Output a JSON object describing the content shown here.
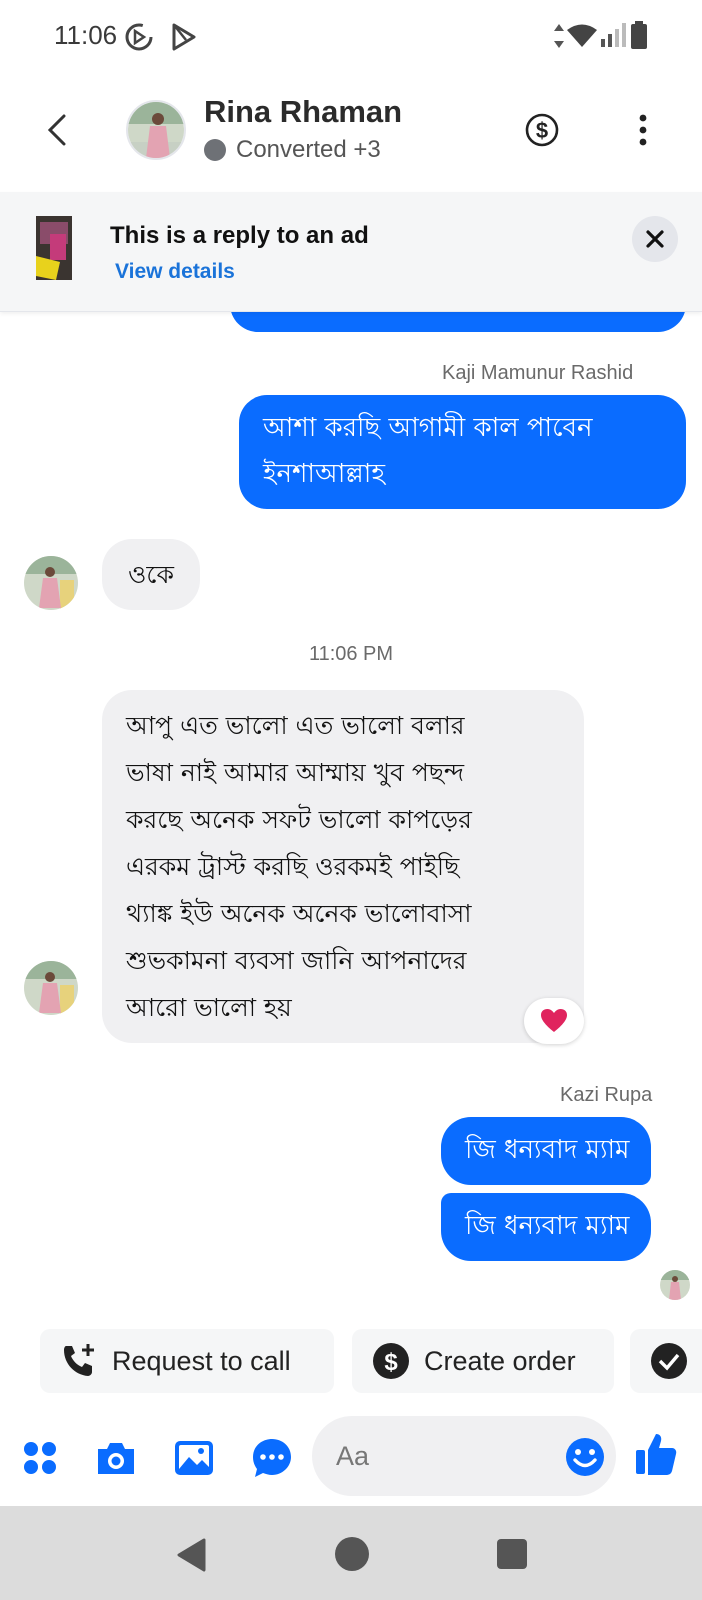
{
  "status_bar": {
    "time": "11:06"
  },
  "header": {
    "name": "Rina Rhaman",
    "status": "Converted +3"
  },
  "ad_banner": {
    "title": "This is a reply to an ad",
    "link": "View details"
  },
  "messages": {
    "sender_1": "Kaji Mamunur Rashid",
    "out_1_line_1": "আশা করছি আগামী কাল পাবেন",
    "out_1_line_2": "ইনশাআল্লাহ",
    "in_1": "ওকে",
    "timestamp": "11:06 PM",
    "in_2_lines": [
      "আপু এত ভালো এত ভালো বলার",
      "ভাষা নাই আমার আম্মায় খুব পছন্দ",
      "করছে অনেক সফট ভালো কাপড়ের",
      "এরকম ট্রাস্ট করছি ওরকমই পাইছি",
      "থ্যাঙ্ক ইউ অনেক অনেক ভালোবাসা",
      "শুভকামনা ব্যবসা জানি আপনাদের",
      "আরো ভালো হয়"
    ],
    "reaction": "heart",
    "sender_2": "Kazi Rupa",
    "out_2": "জি ধন্যবাদ ম্যাম",
    "out_3": "জি ধন্যবাদ ম্যাম"
  },
  "quick_actions": {
    "request_call": "Request to call",
    "create_order": "Create order"
  },
  "composer": {
    "placeholder": "Aa"
  },
  "colors": {
    "accent": "#0a6cff",
    "incoming_bubble": "#f0f0f2",
    "heart": "#e0245e"
  },
  "icons": [
    "back-icon",
    "dollar-icon",
    "more-icon",
    "close-icon",
    "phone-plus-icon",
    "dollar-circle-icon",
    "check-circle-icon",
    "apps-icon",
    "camera-icon",
    "image-icon",
    "chat-icon",
    "emoji-icon",
    "like-icon"
  ]
}
